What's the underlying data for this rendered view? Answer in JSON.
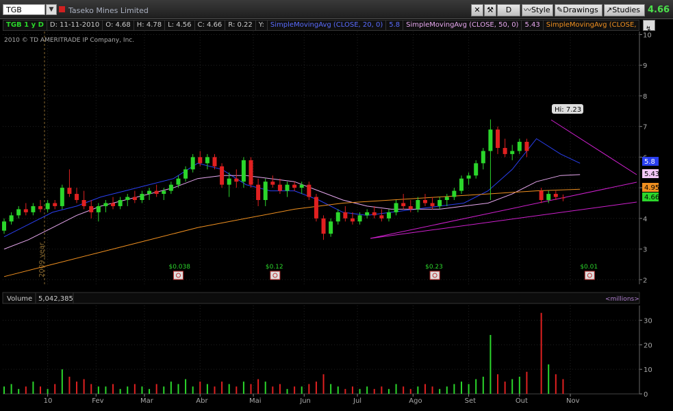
{
  "toolbar": {
    "symbol": "TGB",
    "company": "Taseko Mines Limited",
    "period_button": "D",
    "style_label": "Style",
    "drawings_label": "Drawings",
    "studies_label": "Studies",
    "last_price": "4.66"
  },
  "info": {
    "symbol_period": "TGB 1 y D",
    "date": "D: 11-11-2010",
    "open": "O: 4.68",
    "high": "H: 4.78",
    "low": "L: 4.56",
    "close": "C: 4.66",
    "range": "R: 0.22",
    "y": "Y:",
    "sma20_label": "SimpleMovingAvg (CLOSE, 20, 0)",
    "sma20_value": "5.8",
    "sma50_label": "SimpleMovingAvg (CLOSE, 50, 0)",
    "sma50_value": "5.43",
    "sma200_label": "SimpleMovingAvg (CLOSE, 20..."
  },
  "copyright": "2010 © TD AMERITRADE IP Company, Inc.",
  "year_marker": "2009 year",
  "hi_label": "Hi: 7.23",
  "price_tags": [
    "5.8",
    "5.43",
    "4.95",
    "4.66"
  ],
  "dividends": [
    "$0.038",
    "$0.12",
    "$0.23",
    "$0.01"
  ],
  "volume_panel": {
    "label": "Volume",
    "value": "5,042,385",
    "unit": "<millions>"
  },
  "colors": {
    "up": "#2bd62b",
    "down": "#e02020",
    "sma20": "#2a3ff0",
    "sma50": "#e8a8f0",
    "sma200": "#f09020",
    "trendline": "#d020d0"
  },
  "chart_data": [
    {
      "type": "line",
      "description_free": "",
      "x_ticks": [
        "10",
        "Fev",
        "Mar",
        "Abr",
        "Mai",
        "Jun",
        "Jul",
        "Ago",
        "Set",
        "Out",
        "Nov"
      ],
      "y_ticks": [
        2,
        3,
        4,
        5,
        6,
        7,
        8,
        9,
        10
      ],
      "ylim": [
        1.85,
        10.1
      ],
      "grid": true,
      "series": [
        {
          "name": "SimpleMovingAvg (CLOSE, 20, 0)",
          "x": [
            0,
            10,
            20,
            30,
            40,
            50,
            60,
            70,
            80,
            90,
            100,
            110,
            120,
            130,
            140,
            150,
            160,
            170,
            180,
            190,
            200,
            210,
            220,
            230,
            238
          ],
          "values": [
            3.4,
            3.8,
            4.2,
            4.4,
            4.7,
            4.9,
            5.1,
            5.3,
            5.8,
            5.6,
            5.1,
            4.9,
            4.9,
            4.6,
            4.2,
            4.1,
            4.2,
            4.3,
            4.4,
            4.5,
            4.9,
            5.6,
            6.6,
            6.1,
            5.8
          ]
        },
        {
          "name": "SimpleMovingAvg (CLOSE, 50, 0)",
          "x": [
            0,
            10,
            20,
            30,
            40,
            50,
            60,
            70,
            80,
            90,
            100,
            110,
            120,
            130,
            140,
            150,
            160,
            170,
            180,
            190,
            200,
            210,
            220,
            230,
            238
          ],
          "values": [
            3.0,
            3.3,
            3.7,
            4.1,
            4.4,
            4.6,
            4.8,
            5.0,
            5.3,
            5.4,
            5.4,
            5.3,
            5.2,
            4.9,
            4.6,
            4.4,
            4.3,
            4.3,
            4.3,
            4.4,
            4.5,
            4.8,
            5.2,
            5.4,
            5.43
          ]
        },
        {
          "name": "SimpleMovingAvg (CLOSE, 20...",
          "x": [
            0,
            20,
            40,
            60,
            80,
            100,
            120,
            140,
            160,
            180,
            200,
            220,
            238
          ],
          "values": [
            2.1,
            2.5,
            2.9,
            3.3,
            3.7,
            4.0,
            4.3,
            4.5,
            4.6,
            4.7,
            4.8,
            4.9,
            4.95
          ]
        }
      ],
      "candles": [
        {
          "x": 0,
          "o": 3.6,
          "h": 4.0,
          "l": 3.5,
          "c": 3.9
        },
        {
          "x": 3,
          "o": 3.9,
          "h": 4.2,
          "l": 3.8,
          "c": 4.1
        },
        {
          "x": 6,
          "o": 4.1,
          "h": 4.4,
          "l": 4.0,
          "c": 4.3
        },
        {
          "x": 9,
          "o": 4.3,
          "h": 4.5,
          "l": 4.1,
          "c": 4.2
        },
        {
          "x": 12,
          "o": 4.2,
          "h": 4.5,
          "l": 4.1,
          "c": 4.4
        },
        {
          "x": 15,
          "o": 4.4,
          "h": 4.6,
          "l": 4.2,
          "c": 4.3
        },
        {
          "x": 18,
          "o": 4.3,
          "h": 4.6,
          "l": 4.2,
          "c": 4.5
        },
        {
          "x": 21,
          "o": 4.5,
          "h": 4.6,
          "l": 4.3,
          "c": 4.4
        },
        {
          "x": 24,
          "o": 4.4,
          "h": 5.1,
          "l": 4.3,
          "c": 5.0
        },
        {
          "x": 27,
          "o": 5.0,
          "h": 5.6,
          "l": 4.7,
          "c": 4.8
        },
        {
          "x": 30,
          "o": 4.8,
          "h": 5.0,
          "l": 4.5,
          "c": 4.6
        },
        {
          "x": 33,
          "o": 4.6,
          "h": 4.9,
          "l": 4.3,
          "c": 4.4
        },
        {
          "x": 36,
          "o": 4.4,
          "h": 4.6,
          "l": 4.0,
          "c": 4.2
        },
        {
          "x": 39,
          "o": 4.2,
          "h": 4.5,
          "l": 3.9,
          "c": 4.4
        },
        {
          "x": 42,
          "o": 4.4,
          "h": 4.6,
          "l": 4.2,
          "c": 4.5
        },
        {
          "x": 45,
          "o": 4.5,
          "h": 4.7,
          "l": 4.3,
          "c": 4.4
        },
        {
          "x": 48,
          "o": 4.4,
          "h": 4.7,
          "l": 4.3,
          "c": 4.6
        },
        {
          "x": 51,
          "o": 4.6,
          "h": 4.8,
          "l": 4.4,
          "c": 4.7
        },
        {
          "x": 54,
          "o": 4.7,
          "h": 4.9,
          "l": 4.5,
          "c": 4.6
        },
        {
          "x": 57,
          "o": 4.6,
          "h": 4.9,
          "l": 4.5,
          "c": 4.8
        },
        {
          "x": 60,
          "o": 4.8,
          "h": 5.0,
          "l": 4.6,
          "c": 4.9
        },
        {
          "x": 63,
          "o": 4.9,
          "h": 5.1,
          "l": 4.7,
          "c": 4.8
        },
        {
          "x": 66,
          "o": 4.8,
          "h": 5.0,
          "l": 4.6,
          "c": 4.9
        },
        {
          "x": 69,
          "o": 4.9,
          "h": 5.2,
          "l": 4.8,
          "c": 5.1
        },
        {
          "x": 72,
          "o": 5.1,
          "h": 5.4,
          "l": 5.0,
          "c": 5.3
        },
        {
          "x": 75,
          "o": 5.3,
          "h": 5.7,
          "l": 5.2,
          "c": 5.6
        },
        {
          "x": 78,
          "o": 5.6,
          "h": 6.1,
          "l": 5.5,
          "c": 6.0
        },
        {
          "x": 81,
          "o": 6.0,
          "h": 6.2,
          "l": 5.7,
          "c": 5.8
        },
        {
          "x": 84,
          "o": 5.8,
          "h": 6.1,
          "l": 5.6,
          "c": 6.0
        },
        {
          "x": 87,
          "o": 6.0,
          "h": 6.1,
          "l": 5.6,
          "c": 5.7
        },
        {
          "x": 90,
          "o": 5.7,
          "h": 5.8,
          "l": 5.0,
          "c": 5.1
        },
        {
          "x": 93,
          "o": 5.1,
          "h": 5.5,
          "l": 4.7,
          "c": 5.3
        },
        {
          "x": 96,
          "o": 5.3,
          "h": 5.6,
          "l": 5.0,
          "c": 5.2
        },
        {
          "x": 99,
          "o": 5.2,
          "h": 6.0,
          "l": 5.0,
          "c": 5.9
        },
        {
          "x": 102,
          "o": 5.9,
          "h": 6.0,
          "l": 5.0,
          "c": 5.1
        },
        {
          "x": 105,
          "o": 5.1,
          "h": 5.3,
          "l": 4.4,
          "c": 4.6
        },
        {
          "x": 108,
          "o": 4.6,
          "h": 5.3,
          "l": 4.4,
          "c": 5.2
        },
        {
          "x": 111,
          "o": 5.2,
          "h": 5.4,
          "l": 5.0,
          "c": 5.1
        },
        {
          "x": 114,
          "o": 5.1,
          "h": 5.3,
          "l": 4.8,
          "c": 4.9
        },
        {
          "x": 117,
          "o": 4.9,
          "h": 5.2,
          "l": 4.7,
          "c": 5.1
        },
        {
          "x": 120,
          "o": 5.1,
          "h": 5.2,
          "l": 4.9,
          "c": 5.0
        },
        {
          "x": 123,
          "o": 5.0,
          "h": 5.2,
          "l": 4.8,
          "c": 5.1
        },
        {
          "x": 126,
          "o": 5.1,
          "h": 5.2,
          "l": 4.6,
          "c": 4.7
        },
        {
          "x": 129,
          "o": 4.7,
          "h": 4.8,
          "l": 3.9,
          "c": 4.0
        },
        {
          "x": 132,
          "o": 4.0,
          "h": 4.1,
          "l": 3.3,
          "c": 3.5
        },
        {
          "x": 135,
          "o": 3.5,
          "h": 4.0,
          "l": 3.4,
          "c": 3.9
        },
        {
          "x": 138,
          "o": 3.9,
          "h": 4.3,
          "l": 3.8,
          "c": 4.2
        },
        {
          "x": 141,
          "o": 4.2,
          "h": 4.4,
          "l": 3.9,
          "c": 4.0
        },
        {
          "x": 144,
          "o": 4.0,
          "h": 4.2,
          "l": 3.8,
          "c": 3.9
        },
        {
          "x": 147,
          "o": 3.9,
          "h": 4.2,
          "l": 3.8,
          "c": 4.1
        },
        {
          "x": 150,
          "o": 4.1,
          "h": 4.3,
          "l": 4.0,
          "c": 4.2
        },
        {
          "x": 153,
          "o": 4.2,
          "h": 4.4,
          "l": 4.0,
          "c": 4.1
        },
        {
          "x": 156,
          "o": 4.1,
          "h": 4.3,
          "l": 3.9,
          "c": 4.0
        },
        {
          "x": 159,
          "o": 4.0,
          "h": 4.3,
          "l": 3.9,
          "c": 4.2
        },
        {
          "x": 162,
          "o": 4.2,
          "h": 4.6,
          "l": 4.1,
          "c": 4.5
        },
        {
          "x": 165,
          "o": 4.5,
          "h": 4.8,
          "l": 4.3,
          "c": 4.4
        },
        {
          "x": 168,
          "o": 4.4,
          "h": 4.6,
          "l": 4.2,
          "c": 4.3
        },
        {
          "x": 171,
          "o": 4.3,
          "h": 4.7,
          "l": 4.2,
          "c": 4.6
        },
        {
          "x": 174,
          "o": 4.6,
          "h": 4.8,
          "l": 4.4,
          "c": 4.5
        },
        {
          "x": 177,
          "o": 4.5,
          "h": 4.7,
          "l": 4.3,
          "c": 4.4
        },
        {
          "x": 180,
          "o": 4.4,
          "h": 4.7,
          "l": 4.3,
          "c": 4.6
        },
        {
          "x": 183,
          "o": 4.6,
          "h": 4.8,
          "l": 4.4,
          "c": 4.7
        },
        {
          "x": 186,
          "o": 4.7,
          "h": 5.0,
          "l": 4.6,
          "c": 4.9
        },
        {
          "x": 189,
          "o": 4.9,
          "h": 5.4,
          "l": 4.8,
          "c": 5.3
        },
        {
          "x": 192,
          "o": 5.3,
          "h": 5.5,
          "l": 5.1,
          "c": 5.4
        },
        {
          "x": 195,
          "o": 5.4,
          "h": 5.9,
          "l": 5.3,
          "c": 5.8
        },
        {
          "x": 198,
          "o": 5.8,
          "h": 6.3,
          "l": 5.6,
          "c": 6.2
        },
        {
          "x": 201,
          "o": 6.2,
          "h": 7.23,
          "l": 4.6,
          "c": 6.9
        },
        {
          "x": 204,
          "o": 6.9,
          "h": 7.0,
          "l": 6.1,
          "c": 6.3
        },
        {
          "x": 207,
          "o": 6.3,
          "h": 6.6,
          "l": 6.0,
          "c": 6.1
        },
        {
          "x": 210,
          "o": 6.1,
          "h": 6.4,
          "l": 5.9,
          "c": 6.2
        },
        {
          "x": 213,
          "o": 6.2,
          "h": 6.6,
          "l": 6.1,
          "c": 6.5
        },
        {
          "x": 216,
          "o": 6.5,
          "h": 6.6,
          "l": 6.0,
          "c": 6.2
        },
        {
          "x": 222,
          "o": 4.9,
          "h": 5.0,
          "l": 4.5,
          "c": 4.6
        },
        {
          "x": 225,
          "o": 4.6,
          "h": 4.9,
          "l": 4.5,
          "c": 4.8
        },
        {
          "x": 228,
          "o": 4.8,
          "h": 4.9,
          "l": 4.6,
          "c": 4.7
        },
        {
          "x": 231,
          "o": 4.68,
          "h": 4.78,
          "l": 4.56,
          "c": 4.66
        }
      ]
    },
    {
      "type": "bar",
      "y_ticks": [
        0,
        10,
        20,
        30
      ],
      "ylim": [
        0,
        36
      ],
      "x": [
        0,
        3,
        6,
        9,
        12,
        15,
        18,
        21,
        24,
        27,
        30,
        33,
        36,
        39,
        42,
        45,
        48,
        51,
        54,
        57,
        60,
        63,
        66,
        69,
        72,
        75,
        78,
        81,
        84,
        87,
        90,
        93,
        96,
        99,
        102,
        105,
        108,
        111,
        114,
        117,
        120,
        123,
        126,
        129,
        132,
        135,
        138,
        141,
        144,
        147,
        150,
        153,
        156,
        159,
        162,
        165,
        168,
        171,
        174,
        177,
        180,
        183,
        186,
        189,
        192,
        195,
        198,
        201,
        204,
        207,
        210,
        213,
        216,
        222,
        225,
        228,
        231
      ],
      "values": [
        3,
        4,
        2,
        3,
        5,
        3,
        2,
        4,
        10,
        7,
        5,
        6,
        4,
        3,
        3,
        4,
        2,
        3,
        4,
        3,
        2,
        4,
        3,
        5,
        4,
        6,
        3,
        5,
        4,
        3,
        5,
        4,
        3,
        5,
        4,
        6,
        5,
        3,
        4,
        2,
        3,
        3,
        4,
        5,
        8,
        4,
        3,
        2,
        3,
        2,
        3,
        2,
        3,
        2,
        4,
        3,
        2,
        3,
        4,
        3,
        2,
        3,
        4,
        5,
        4,
        6,
        7,
        24,
        8,
        5,
        6,
        7,
        9,
        33,
        12,
        8,
        6
      ],
      "up": [
        true,
        true,
        true,
        false,
        true,
        false,
        true,
        false,
        true,
        false,
        false,
        false,
        false,
        true,
        true,
        false,
        true,
        true,
        false,
        true,
        true,
        false,
        true,
        true,
        true,
        true,
        true,
        false,
        true,
        false,
        false,
        true,
        false,
        true,
        false,
        false,
        true,
        false,
        false,
        true,
        false,
        true,
        false,
        false,
        false,
        true,
        true,
        false,
        false,
        true,
        true,
        false,
        false,
        true,
        true,
        false,
        false,
        true,
        false,
        false,
        true,
        true,
        true,
        true,
        true,
        true,
        true,
        true,
        false,
        false,
        true,
        true,
        false,
        false,
        true,
        false,
        false
      ]
    }
  ]
}
